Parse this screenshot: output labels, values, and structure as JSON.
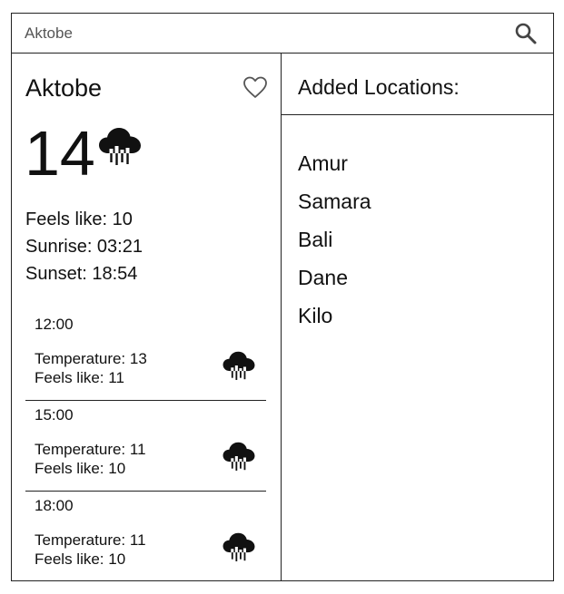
{
  "search": {
    "value": "Aktobe",
    "icon": "search-icon"
  },
  "current": {
    "city": "Aktobe",
    "temperature": "14",
    "weather_icon": "cloud-rain-icon",
    "favorite_icon": "heart-icon",
    "feels_like": "Feels like: 10",
    "sunrise": "Sunrise: 03:21",
    "sunset": "Sunset: 18:54"
  },
  "forecast": [
    {
      "time": "12:00",
      "temperature": "Temperature: 13",
      "feels_like": "Feels like: 11",
      "icon": "cloud-rain-icon"
    },
    {
      "time": "15:00",
      "temperature": "Temperature: 11",
      "feels_like": "Feels like: 10",
      "icon": "cloud-rain-icon"
    },
    {
      "time": "18:00",
      "temperature": "Temperature: 11",
      "feels_like": "Feels like: 10",
      "icon": "cloud-rain-icon"
    }
  ],
  "locations": {
    "title": "Added Locations:",
    "items": [
      "Amur",
      "Samara",
      "Bali",
      "Dane",
      "Kilo"
    ]
  }
}
